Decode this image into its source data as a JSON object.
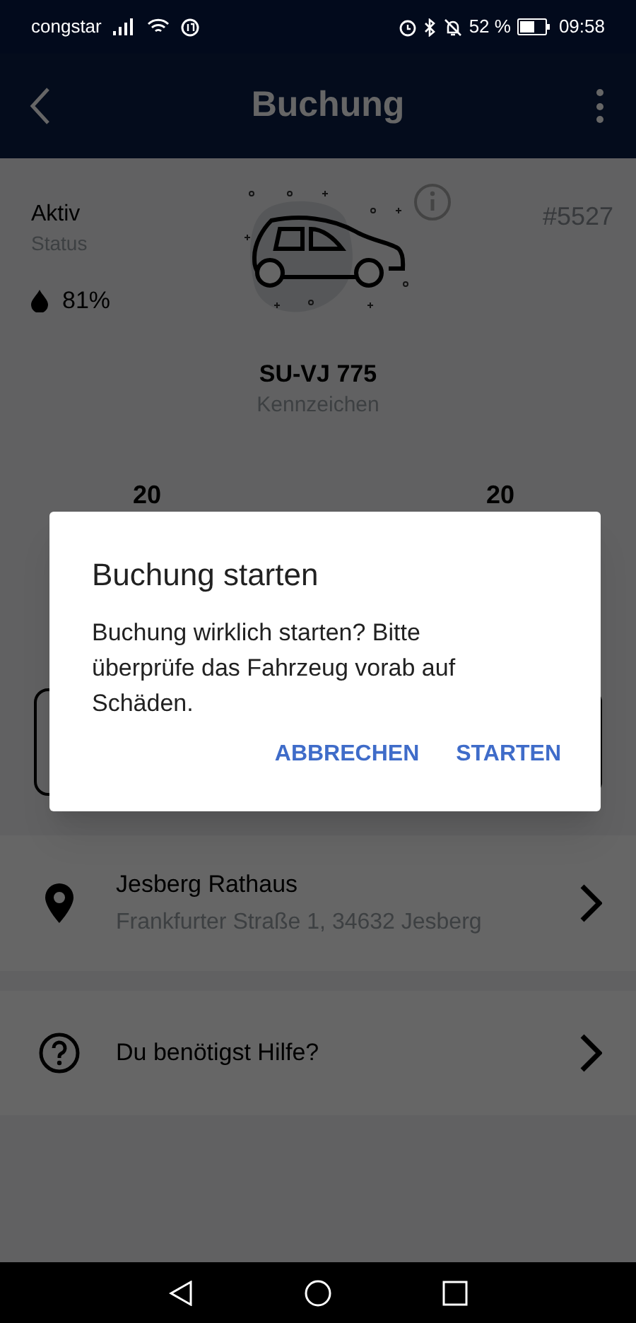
{
  "status_bar": {
    "carrier": "congstar",
    "battery_text": "52 %",
    "time": "09:58"
  },
  "app_bar": {
    "title": "Buchung"
  },
  "booking": {
    "status_value": "Aktiv",
    "status_label": "Status",
    "fuel": "81%",
    "booking_number": "#5527",
    "plate": "SU-VJ 775",
    "plate_label": "Kennzeichen",
    "times": [
      "20",
      "20"
    ]
  },
  "list": [
    {
      "kind": "location",
      "title": "Jesberg Rathaus",
      "subtitle": "Frankfurter Straße 1, 34632 Jesberg"
    },
    {
      "kind": "help",
      "title": "Du benötigst Hilfe?"
    }
  ],
  "dialog": {
    "title": "Buchung starten",
    "message": "Buchung wirklich starten? Bitte überprüfe das Fahrzeug vorab auf Schäden.",
    "buttons": [
      "ABBRECHEN",
      "STARTEN"
    ]
  }
}
